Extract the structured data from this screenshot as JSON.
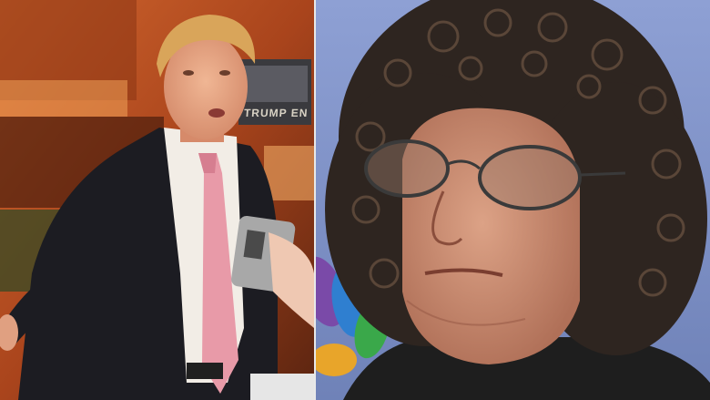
{
  "left_photo": {
    "sign_text": "TRUMP ENTERTAINMENT"
  },
  "colors": {
    "wall_amber": "#b8572a",
    "suit": "#1c1c22",
    "tie_pink": "#e89aa8",
    "shirt": "#f2ede6",
    "hair_light": "#d9a55a",
    "curly_hair": "#2e2520",
    "backdrop_blue": "#7d8fc4",
    "skin_right": "#c98f72"
  }
}
